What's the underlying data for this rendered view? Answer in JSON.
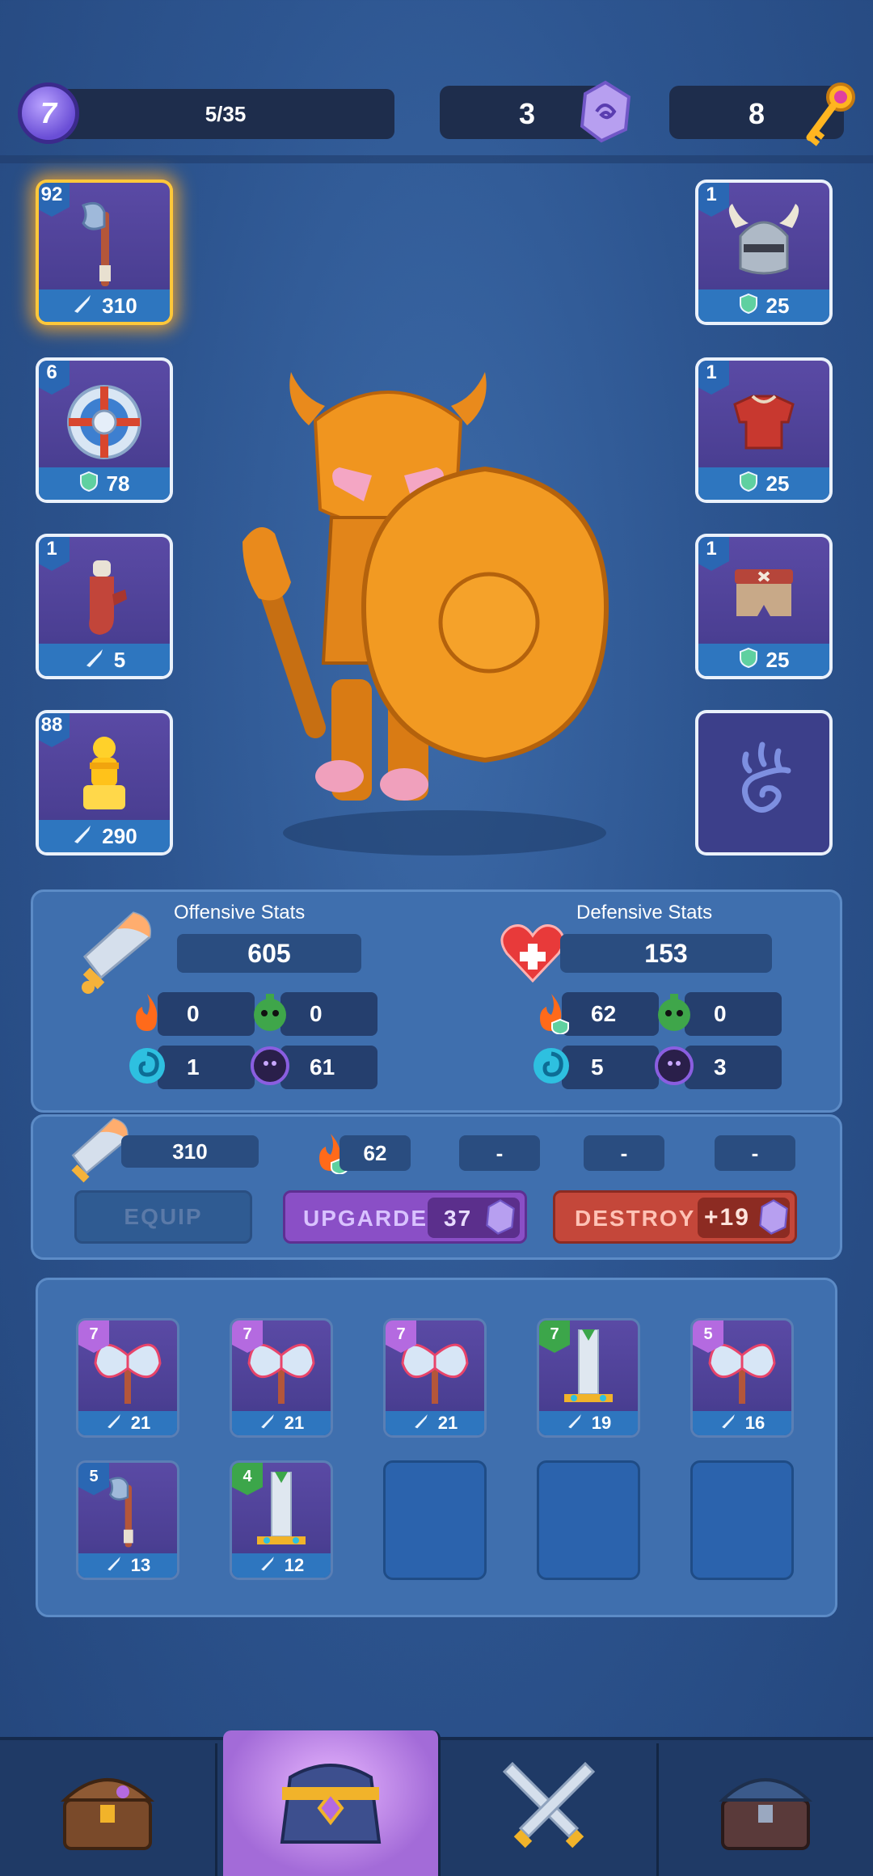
{
  "top_bar": {
    "level": "7",
    "xp_progress": "5/35",
    "gems": "3",
    "keys": "8"
  },
  "equipment_left": [
    {
      "level": "92",
      "value": "310",
      "stat_icon": "sword-icon",
      "item": "axe",
      "selected": true
    },
    {
      "level": "6",
      "value": "78",
      "stat_icon": "shield-icon",
      "item": "round-shield"
    },
    {
      "level": "1",
      "value": "5",
      "stat_icon": "sword-icon",
      "item": "gloves"
    },
    {
      "level": "88",
      "value": "290",
      "stat_icon": "sword-icon",
      "item": "golden-idol"
    }
  ],
  "equipment_right": [
    {
      "level": "1",
      "value": "25",
      "stat_icon": "shield-icon",
      "item": "horned-helmet"
    },
    {
      "level": "1",
      "value": "25",
      "stat_icon": "shield-icon",
      "item": "red-armor"
    },
    {
      "level": "1",
      "value": "25",
      "stat_icon": "shield-icon",
      "item": "pants"
    },
    {
      "item": "pet-paw",
      "empty": true
    }
  ],
  "stats": {
    "offensive_title": "Offensive Stats",
    "offensive_value": "605",
    "offensive_sub": [
      "0",
      "0",
      "1",
      "61"
    ],
    "defensive_title": "Defensive Stats",
    "defensive_value": "153",
    "defensive_sub": [
      "62",
      "0",
      "5",
      "3"
    ]
  },
  "item_detail": {
    "attack": "310",
    "fire": "62",
    "slot3": "-",
    "slot4": "-",
    "slot5": "-",
    "equip_label": "EQUIP",
    "upgrade_label": "UPGARDE",
    "upgrade_cost": "37",
    "destroy_label": "DESTROY",
    "destroy_reward": "+19"
  },
  "inventory": [
    {
      "level": "7",
      "value": "21",
      "badge_color": "#b46ae0",
      "item": "double-axe"
    },
    {
      "level": "7",
      "value": "21",
      "badge_color": "#b46ae0",
      "item": "double-axe"
    },
    {
      "level": "7",
      "value": "21",
      "badge_color": "#b46ae0",
      "item": "double-axe"
    },
    {
      "level": "7",
      "value": "19",
      "badge_color": "#3ca64a",
      "item": "sword"
    },
    {
      "level": "5",
      "value": "16",
      "badge_color": "#b46ae0",
      "item": "double-axe"
    },
    {
      "level": "5",
      "value": "13",
      "badge_color": "#2a67b3",
      "item": "axe"
    },
    {
      "level": "4",
      "value": "12",
      "badge_color": "#3ca64a",
      "item": "sword"
    }
  ],
  "nav": [
    "shop-chest",
    "inventory-bag",
    "battle-swords",
    "locked-chest"
  ],
  "colors": {
    "bg": "#2d5590",
    "gold": "#ffc83a",
    "upgrade": "#8a4fc6",
    "destroy": "#c4473a"
  }
}
